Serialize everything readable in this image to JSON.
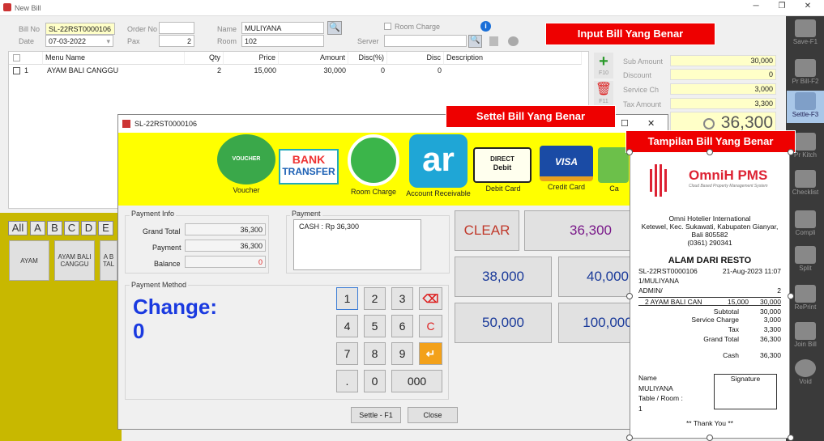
{
  "window": {
    "title": "New Bill",
    "min": "─",
    "max": "❐",
    "close": "✕"
  },
  "header": {
    "bill_no_label": "Bill No",
    "bill_no": "SL-22RST0000106",
    "date_label": "Date",
    "date": "07-03-2022",
    "order_no_label": "Order No",
    "order_no": "",
    "pax_label": "Pax",
    "pax": "2",
    "name_label": "Name",
    "name": "MULIYANA",
    "room_label": "Room",
    "room": "102",
    "room_charge_label": "Room Charge",
    "server_label": "Server",
    "server": ""
  },
  "grid": {
    "columns": [
      "",
      "Menu Name",
      "Qty",
      "Price",
      "Amount",
      "Disc(%)",
      "Disc",
      "Description"
    ],
    "rows": [
      [
        "1",
        "AYAM BALI CANGGU",
        "2",
        "15,000",
        "30,000",
        "0",
        "0",
        ""
      ]
    ]
  },
  "side_actions": {
    "add_label": "F10",
    "delete_label": "F11"
  },
  "summary": {
    "sub_amount_label": "Sub Amount",
    "sub_amount": "30,000",
    "discount_label": "Discount",
    "discount": "0",
    "service_label": "Service Ch",
    "service": "3,000",
    "tax_label": "Tax Amount",
    "tax": "3,300",
    "total": "36,300"
  },
  "right_toolbar": [
    {
      "label": "Save-F1"
    },
    {
      "label": "Pr Bill-F2"
    },
    {
      "label": "Settle-F3"
    },
    {
      "label": "Pr Kitch"
    },
    {
      "label": "Checklist"
    },
    {
      "label": "Compli"
    },
    {
      "label": "Split"
    },
    {
      "label": "RePrint"
    },
    {
      "label": "Join Bill"
    },
    {
      "label": "Void"
    }
  ],
  "categories": [
    "All",
    "A",
    "B",
    "C",
    "D",
    "E"
  ],
  "items": [
    "AYAM",
    "AYAM BALI CANGGU",
    "A B TAL"
  ],
  "annotations": {
    "input": "Input Bill Yang Benar",
    "settle": "Settel Bill Yang Benar",
    "receipt": "Tampilan Bill Yang Benar"
  },
  "dialog": {
    "title": "SL-22RST0000106",
    "payment_methods": [
      "Voucher",
      "",
      "Room Charge",
      "Account Receivable",
      "Debit Card",
      "Credit Card",
      "Ca"
    ],
    "voucher_text": "VOUCHER",
    "bank_text_1": "BANK",
    "bank_text_2": "TRANSFER",
    "ar_text": "ar",
    "direct_debit_1": "DIRECT",
    "direct_debit_2": "Debit",
    "visa_text": "VISA",
    "payment_info_label": "Payment Info",
    "grand_total_label": "Grand Total",
    "grand_total": "36,300",
    "payment_label": "Payment",
    "payment": "36,300",
    "balance_label": "Balance",
    "balance": "0",
    "payment_box_label": "Payment",
    "payment_line": "CASH :  Rp 36,300",
    "payment_method_label": "Payment Method",
    "change_label": "Change:",
    "change_value": "0",
    "keys": [
      "1",
      "2",
      "3",
      "4",
      "5",
      "6",
      "7",
      "8",
      "9",
      ".",
      "0",
      "000"
    ],
    "clear_label": "C",
    "quick": [
      "CLEAR",
      "36,300",
      "38,000",
      "40,000",
      "50,000",
      "100,000"
    ],
    "settle_button": "Settle - F1",
    "close_button": "Close"
  },
  "receipt": {
    "logo_text": "OmniH PMS",
    "logo_sub": "Cloud Based Property Management System",
    "hotel": "Omni Hotelier International",
    "addr1": "Ketewel, Kec. Sukawati, Kabupaten Gianyar,",
    "addr2": "Bali 805582",
    "phone": "(0361) 290341",
    "outlet": "ALAM DARI RESTO",
    "bill_no": "SL-22RST0000106",
    "datetime": "21-Aug-2023  11:07",
    "guest_line": "1/MULIYANA",
    "admin": "ADMIN/",
    "admin_pax": "2",
    "item_line": "2   AYAM BALI CAN",
    "item_price": "15,000",
    "item_amount": "30,000",
    "subtotal_label": "Subtotal",
    "subtotal": "30,000",
    "service_label": "Service Charge",
    "service": "3,000",
    "tax_label": "Tax",
    "tax": "3,300",
    "grand_label": "Grand Total",
    "grand": "36,300",
    "cash_label": "Cash",
    "cash": "36,300",
    "name_label": "Name",
    "name": "MULIYANA",
    "room_label": "Table / Room :",
    "room": "1",
    "signature_label": "Signature",
    "thanks": "** Thank You **"
  }
}
